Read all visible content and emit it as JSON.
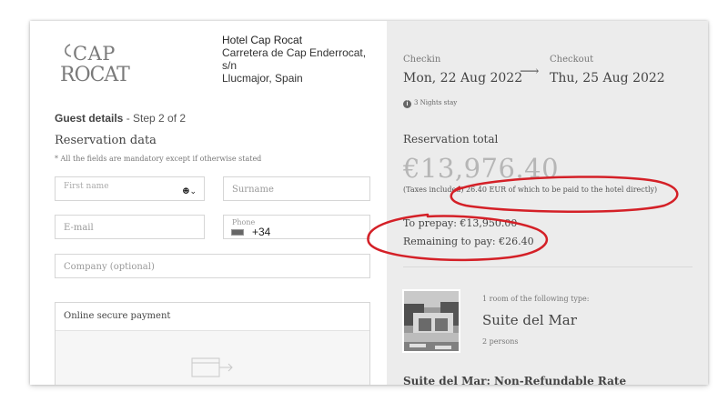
{
  "hotel": {
    "logo_line1": "CAP",
    "logo_line2": "ROCAT",
    "name": "Hotel Cap Rocat",
    "address_line1": "Carretera de Cap Enderrocat,",
    "address_line2": "s/n",
    "address_line3": "Llucmajor, Spain"
  },
  "form": {
    "step_title_bold": "Guest details",
    "step_title_rest": " - Step 2 of 2",
    "section_title": "Reservation data",
    "mandatory_note": "* All the fields are mandatory except if otherwise stated",
    "first_name_placeholder": "First name",
    "surname_placeholder": "Surname",
    "email_placeholder": "E-mail",
    "phone_placeholder": "Phone",
    "phone_code": "+34",
    "company_placeholder": "Company (optional)",
    "payment_title": "Online secure payment"
  },
  "summary": {
    "checkin_label": "Checkin",
    "checkin_date": "Mon, 22 Aug 2022",
    "checkout_label": "Checkout",
    "checkout_date": "Thu, 25 Aug 2022",
    "nights": "3 Nights stay",
    "total_label": "Reservation total",
    "total_amount": "€13,976.40",
    "taxes_note": "(Taxes included) 26.40 EUR of which to be paid to the hotel directly)",
    "prepay": "To prepay: €13,950.00",
    "remaining": "Remaining to pay: €26.40",
    "room_note": "1 room of the following type:",
    "room_name": "Suite del Mar",
    "room_persons": "2 persons",
    "rate_name": "Suite del Mar: Non-Refundable Rate"
  },
  "colors": {
    "annotation": "#d42027",
    "summary_bg": "#ececec",
    "total_amount": "#b6b6b6"
  }
}
